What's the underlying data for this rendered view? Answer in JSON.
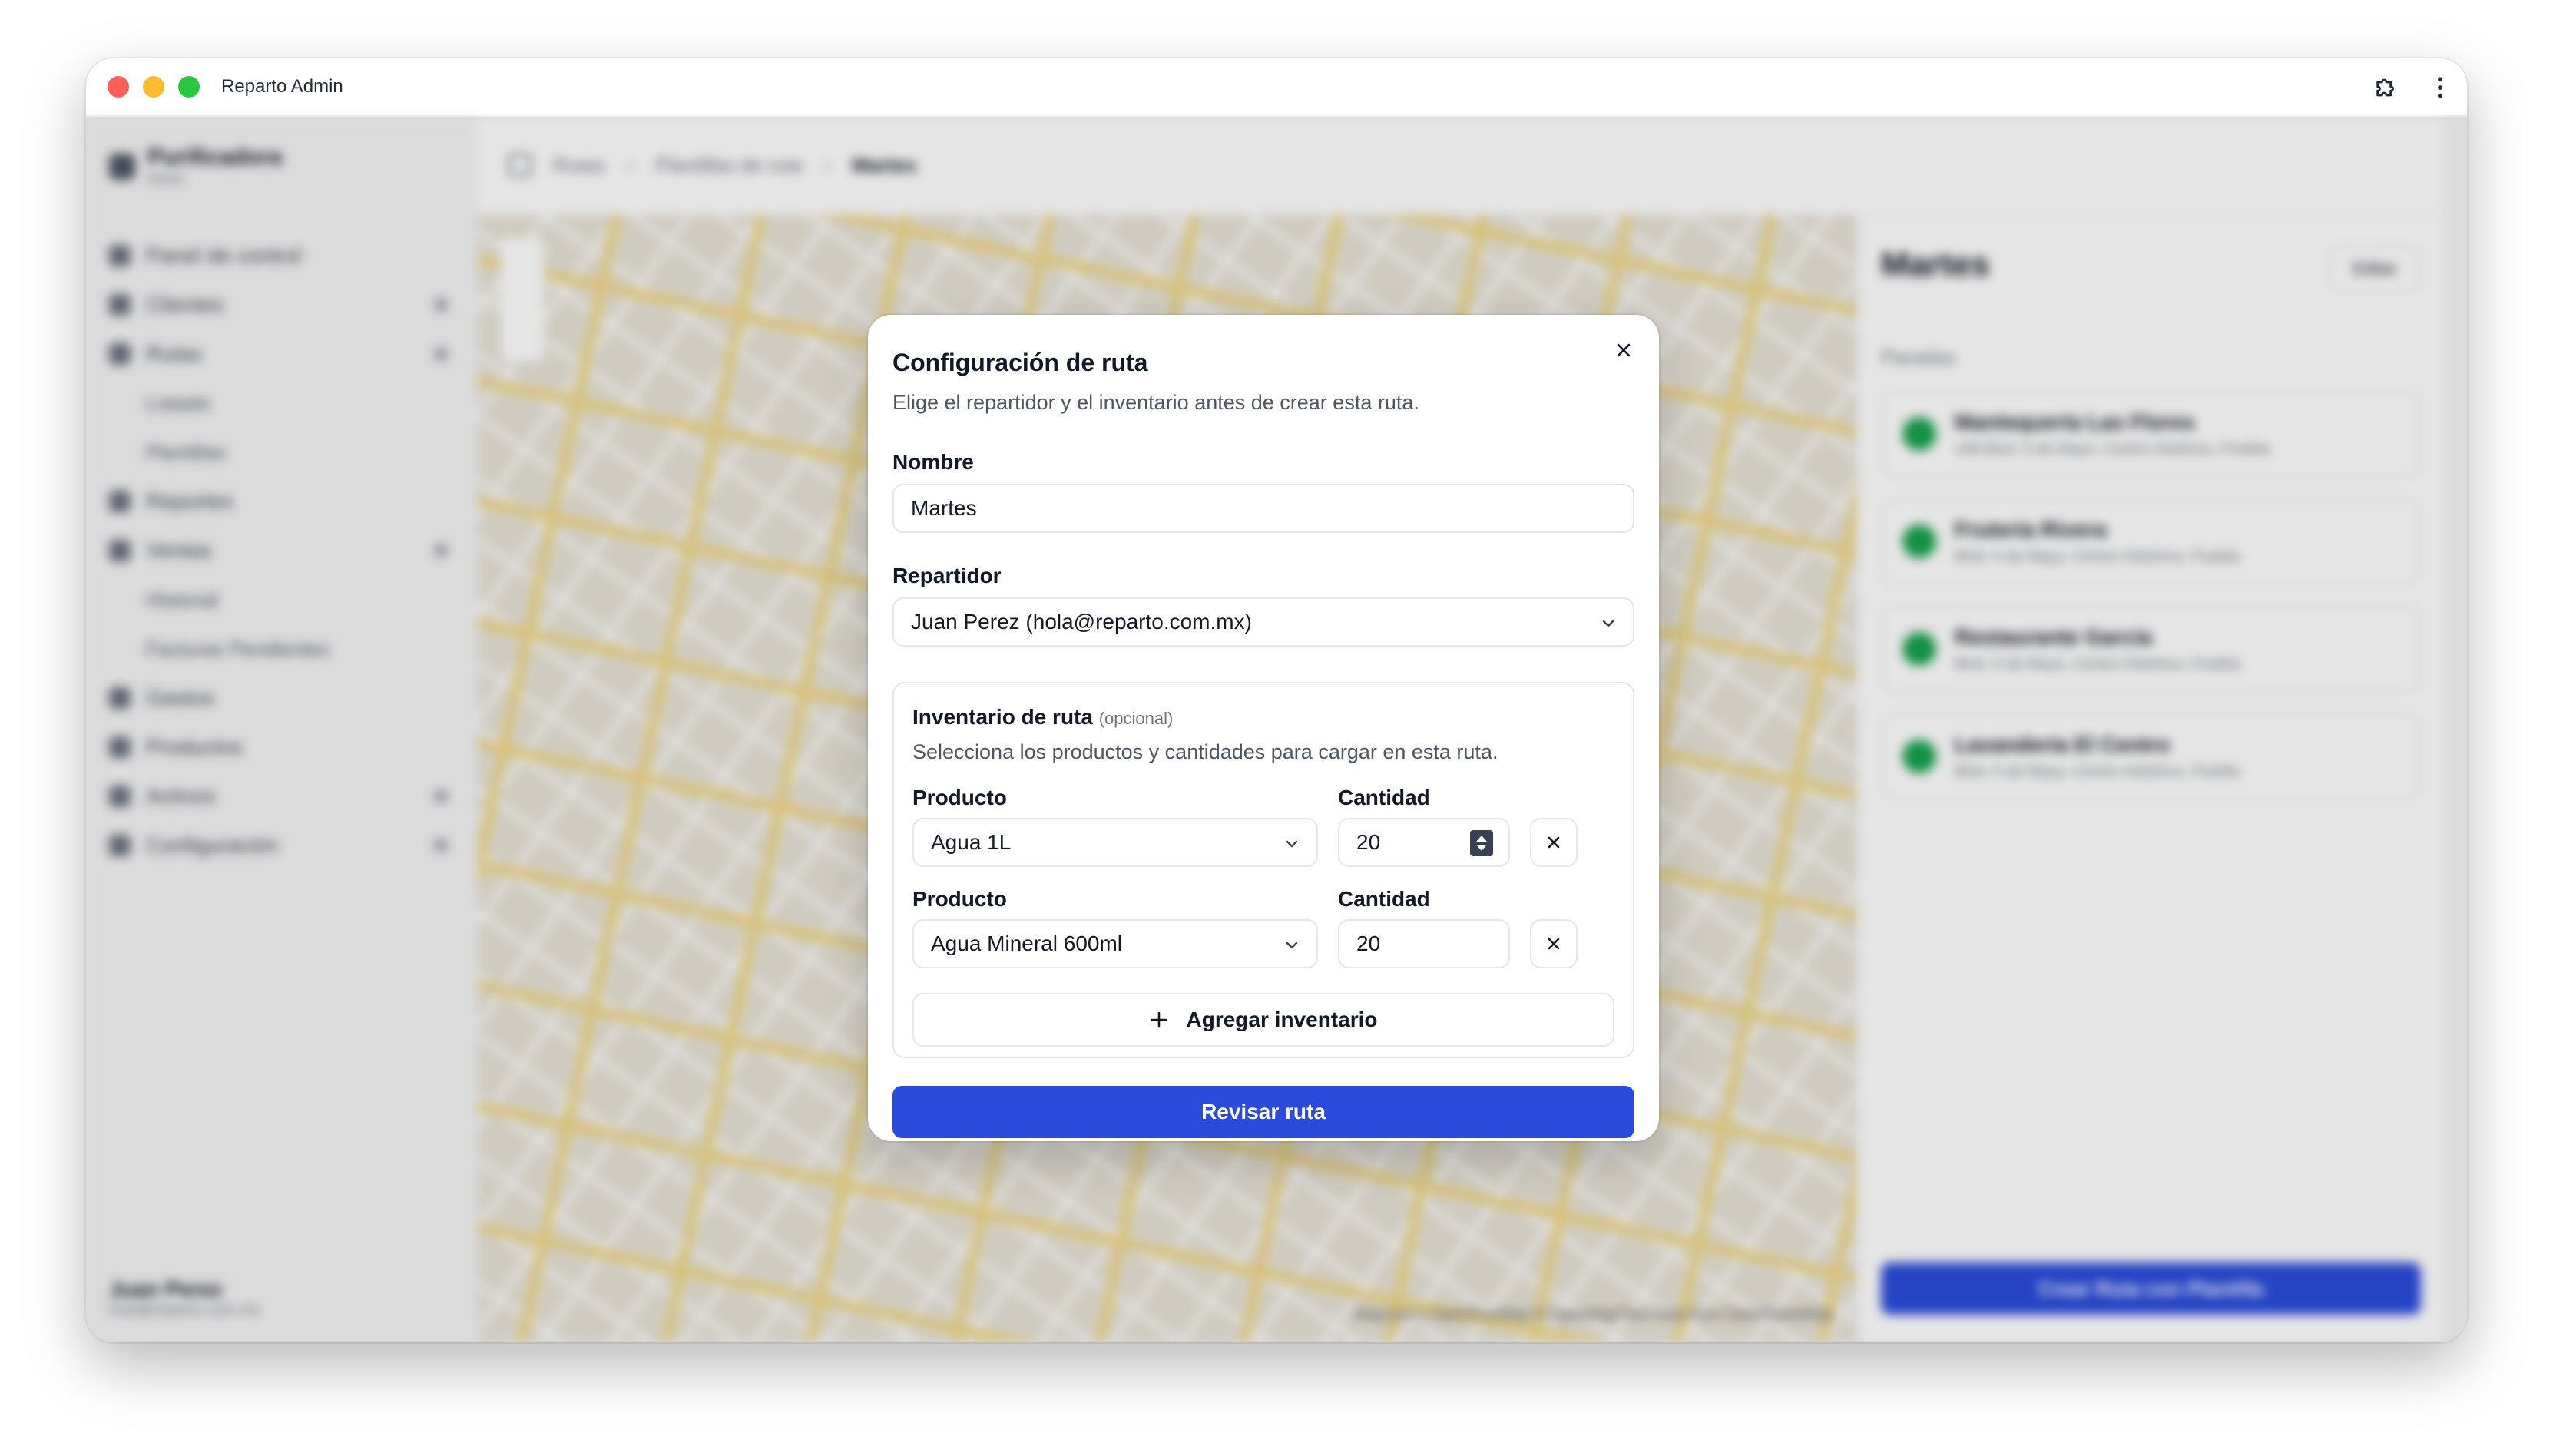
{
  "window": {
    "title": "Reparto Admin"
  },
  "background": {
    "brand": {
      "name": "Purificadora",
      "sub": "Inicio"
    },
    "nav": [
      {
        "label": "Panel de control"
      },
      {
        "label": "Clientes"
      },
      {
        "label": "Rutas"
      },
      {
        "label": "Listado",
        "sub": true
      },
      {
        "label": "Plantillas",
        "sub": true
      },
      {
        "label": "Reportes"
      },
      {
        "label": "Ventas"
      },
      {
        "label": "Historial",
        "sub": true
      },
      {
        "label": "Facturas Pendientes",
        "sub": true
      },
      {
        "label": "Gastos"
      },
      {
        "label": "Productos"
      },
      {
        "label": "Activos"
      },
      {
        "label": "Configuración"
      }
    ],
    "user": {
      "name": "Juan Perez",
      "email": "hola@reparto.com.mx"
    },
    "breadcrumb": [
      "Rutas",
      "Plantillas de ruta",
      "Martes"
    ],
    "map_credit": "MapLibre | OpenFreeMap © OpenMapTiles Data from OpenStreetMap",
    "route_panel": {
      "title": "Martes",
      "edit_label": "Editar",
      "section_label": "Paradas",
      "stops": [
        {
          "name": "Mantequería Las Flores",
          "address": "198 Blvd. 5 de Mayo, Centro Histórico, Puebla"
        },
        {
          "name": "Frutería Rivera",
          "address": "Blvd. 5 de Mayo, Centro Histórico, Puebla"
        },
        {
          "name": "Restaurante García",
          "address": "Blvd. 5 de Mayo, Centro Histórico, Puebla"
        },
        {
          "name": "Lavandería El Centro",
          "address": "Blvd. 5 de Mayo, Centro Histórico, Puebla"
        }
      ],
      "cta_label": "Crear Ruta con Plantilla"
    }
  },
  "modal": {
    "title": "Configuración de ruta",
    "description": "Elige el repartidor y el inventario antes de crear esta ruta.",
    "nombre": {
      "label": "Nombre",
      "value": "Martes"
    },
    "repartidor": {
      "label": "Repartidor",
      "value": "Juan Perez (hola@reparto.com.mx)"
    },
    "inventory": {
      "title": "Inventario de ruta",
      "optional": "(opcional)",
      "description": "Selecciona los productos y cantidades para cargar en esta ruta.",
      "rows": [
        {
          "product_label": "Producto",
          "product": "Agua 1L",
          "qty_label": "Cantidad",
          "qty": "20"
        },
        {
          "product_label": "Producto",
          "product": "Agua Mineral 600ml",
          "qty_label": "Cantidad",
          "qty": "20"
        }
      ],
      "add_label": "Agregar inventario"
    },
    "submit_label": "Revisar ruta"
  },
  "colors": {
    "primary": "#2a4bdb",
    "success": "#16a34a"
  }
}
